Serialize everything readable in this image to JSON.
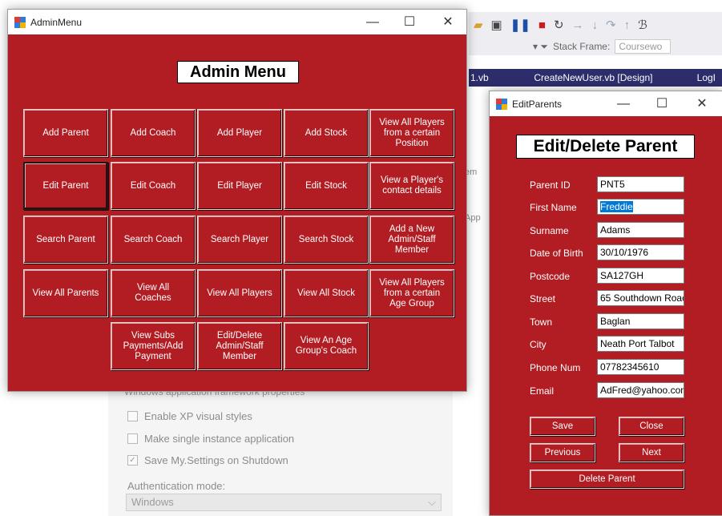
{
  "background": {
    "stack_frame_label": "Stack Frame:",
    "stack_frame_value": "Coursewo",
    "tabs": [
      "1.vb",
      "CreateNewUser.vb [Design]",
      "LogI"
    ],
    "side_bits": [
      "em",
      "App"
    ],
    "framework_legend": "Windows application framework properties",
    "checkboxes": [
      {
        "label": "Enable XP visual styles",
        "checked": false
      },
      {
        "label": "Make single instance application",
        "checked": false
      },
      {
        "label": "Save My.Settings on Shutdown",
        "checked": true
      }
    ],
    "auth_label": "Authentication mode:",
    "auth_value": "Windows"
  },
  "admin_window": {
    "title": "AdminMenu",
    "heading": "Admin Menu",
    "buttons": [
      [
        "Add Parent",
        "Add Coach",
        "Add Player",
        "Add Stock",
        "View All Players\nfrom a certain\nPosition"
      ],
      [
        "Edit Parent",
        "Edit Coach",
        "Edit Player",
        "Edit Stock",
        "View a Player's\ncontact details"
      ],
      [
        "Search Parent",
        "Search Coach",
        "Search Player",
        "Search Stock",
        "Add a New\nAdmin/Staff\nMember"
      ],
      [
        "View All Parents",
        "View All\nCoaches",
        "View All Players",
        "View All Stock",
        "View All Players\nfrom a certain\nAge Group"
      ],
      [
        "View Subs\nPayments/Add\nPayment",
        "Edit/Delete\nAdmin/Staff\nMember",
        "View An Age\nGroup's Coach"
      ]
    ]
  },
  "edit_window": {
    "title": "EditParents",
    "heading": "Edit/Delete Parent",
    "fields": [
      {
        "label": "Parent ID",
        "value": "PNT5"
      },
      {
        "label": "First Name",
        "value": "Freddie"
      },
      {
        "label": "Surname",
        "value": "Adams"
      },
      {
        "label": "Date of Birth",
        "value": "30/10/1976"
      },
      {
        "label": "Postcode",
        "value": "SA127GH"
      },
      {
        "label": "Street",
        "value": "65 Southdown Roac"
      },
      {
        "label": "Town",
        "value": "Baglan"
      },
      {
        "label": "City",
        "value": "Neath Port Talbot"
      },
      {
        "label": "Phone Num",
        "value": "07782345610"
      },
      {
        "label": "Email",
        "value": "AdFred@yahoo.com"
      }
    ],
    "buttons": {
      "save": "Save",
      "close": "Close",
      "previous": "Previous",
      "next": "Next",
      "delete": "Delete Parent"
    }
  }
}
